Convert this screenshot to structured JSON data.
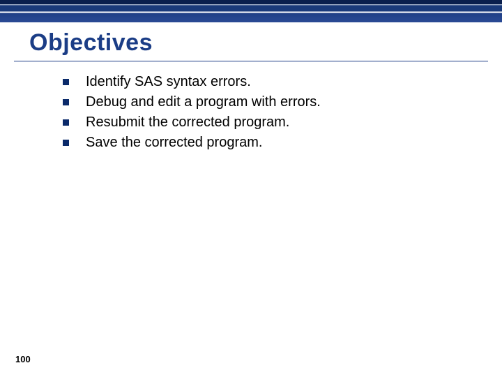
{
  "title": "Objectives",
  "bullets": [
    "Identify SAS syntax errors.",
    "Debug and edit a program with errors.",
    "Resubmit the corrected program.",
    "Save the corrected program."
  ],
  "page_number": "100"
}
